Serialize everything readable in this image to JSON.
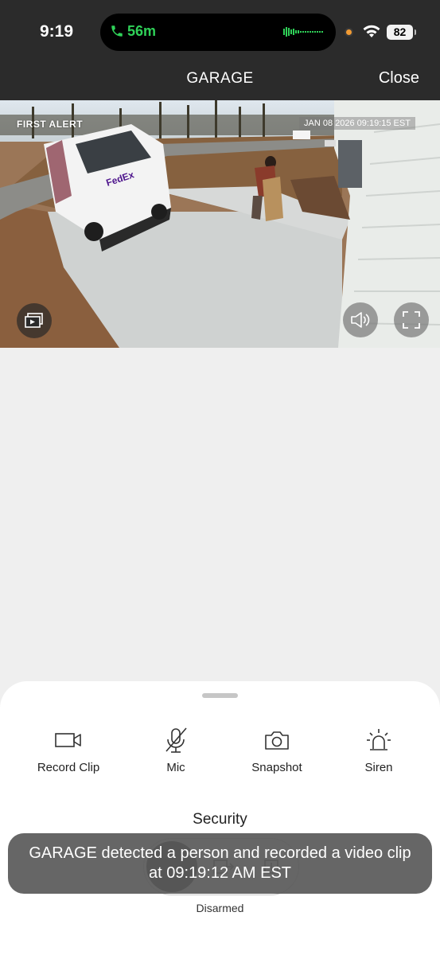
{
  "status_bar": {
    "time": "9:19",
    "call_duration": "56m",
    "battery": "82"
  },
  "header": {
    "title": "GARAGE",
    "close_label": "Close"
  },
  "camera": {
    "brand": "FIRST ALERT",
    "timestamp": "JAN 08 2026 09:19:15 EST",
    "van_logo": "FedEx"
  },
  "actions": [
    {
      "label": "Record Clip",
      "icon": "video-camera-icon"
    },
    {
      "label": "Mic",
      "icon": "mic-off-icon"
    },
    {
      "label": "Snapshot",
      "icon": "camera-icon"
    },
    {
      "label": "Siren",
      "icon": "siren-icon"
    }
  ],
  "security": {
    "title": "Security",
    "status": "Disarmed"
  },
  "toast": {
    "message": "GARAGE  detected a person and recorded a video clip at 09:19:12 AM EST"
  },
  "colors": {
    "call_green": "#2fd158",
    "header_bg": "#2b2b2b",
    "page_bg": "#efefef"
  }
}
